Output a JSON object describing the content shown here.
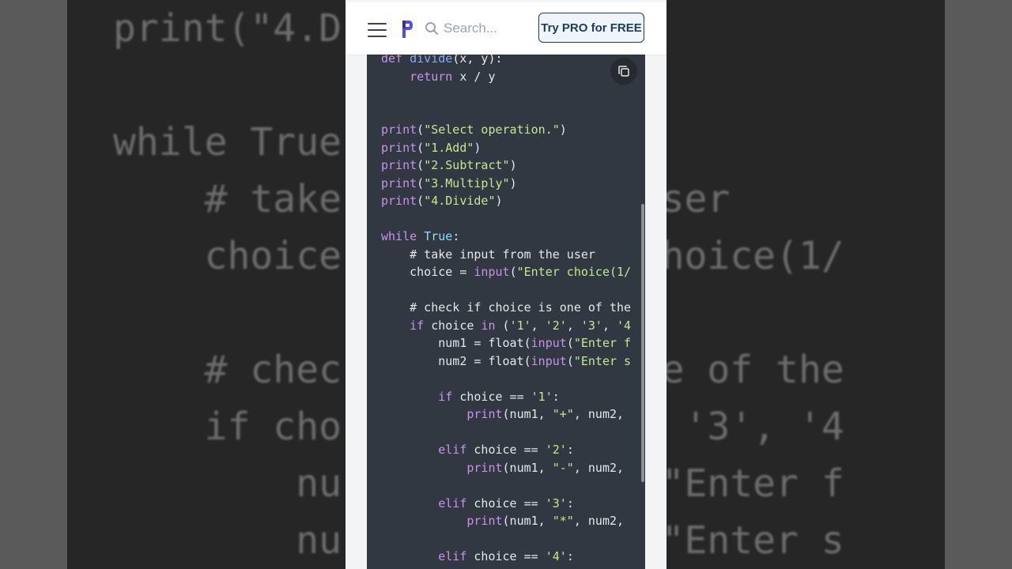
{
  "header": {
    "search_placeholder": "Search...",
    "pro_button_label": "Try PRO for FREE"
  },
  "background_code": {
    "lines": [
      "print(\"4.D",
      "",
      "while True",
      "    # take          he user",
      "    choice          er choice(1/",
      "",
      "    # chec          s one of the",
      "    if cho          '2', '3', '4",
      "        nu          put(\"Enter f",
      "        nu          put(\"Enter s"
    ]
  },
  "code": {
    "lines": [
      [
        {
          "t": "def ",
          "c": "kw"
        },
        {
          "t": "divide",
          "c": "fn"
        },
        {
          "t": "(x, y):",
          "c": ""
        }
      ],
      [
        {
          "t": "    ",
          "c": ""
        },
        {
          "t": "return",
          "c": "kw"
        },
        {
          "t": " x / y",
          "c": ""
        }
      ],
      [],
      [],
      [
        {
          "t": "print",
          "c": "bi"
        },
        {
          "t": "(",
          "c": ""
        },
        {
          "t": "\"Select operation.\"",
          "c": "str"
        },
        {
          "t": ")",
          "c": ""
        }
      ],
      [
        {
          "t": "print",
          "c": "bi"
        },
        {
          "t": "(",
          "c": ""
        },
        {
          "t": "\"1.Add\"",
          "c": "str"
        },
        {
          "t": ")",
          "c": ""
        }
      ],
      [
        {
          "t": "print",
          "c": "bi"
        },
        {
          "t": "(",
          "c": ""
        },
        {
          "t": "\"2.Subtract\"",
          "c": "str"
        },
        {
          "t": ")",
          "c": ""
        }
      ],
      [
        {
          "t": "print",
          "c": "bi"
        },
        {
          "t": "(",
          "c": ""
        },
        {
          "t": "\"3.Multiply\"",
          "c": "str"
        },
        {
          "t": ")",
          "c": ""
        }
      ],
      [
        {
          "t": "print",
          "c": "bi"
        },
        {
          "t": "(",
          "c": ""
        },
        {
          "t": "\"4.Divide\"",
          "c": "str"
        },
        {
          "t": ")",
          "c": ""
        }
      ],
      [],
      [
        {
          "t": "while ",
          "c": "kw"
        },
        {
          "t": "True",
          "c": "tr"
        },
        {
          "t": ":",
          "c": ""
        }
      ],
      [
        {
          "t": "    # take input from the user",
          "c": "cm"
        }
      ],
      [
        {
          "t": "    choice = ",
          "c": ""
        },
        {
          "t": "input",
          "c": "bi"
        },
        {
          "t": "(",
          "c": ""
        },
        {
          "t": "\"Enter choice(1/",
          "c": "str"
        }
      ],
      [],
      [
        {
          "t": "    # check if choice is one of the",
          "c": "cm"
        }
      ],
      [
        {
          "t": "    ",
          "c": ""
        },
        {
          "t": "if",
          "c": "kw"
        },
        {
          "t": " choice ",
          "c": ""
        },
        {
          "t": "in",
          "c": "kw"
        },
        {
          "t": " (",
          "c": ""
        },
        {
          "t": "'1'",
          "c": "str"
        },
        {
          "t": ", ",
          "c": ""
        },
        {
          "t": "'2'",
          "c": "str"
        },
        {
          "t": ", ",
          "c": ""
        },
        {
          "t": "'3'",
          "c": "str"
        },
        {
          "t": ", ",
          "c": ""
        },
        {
          "t": "'4",
          "c": "str"
        }
      ],
      [
        {
          "t": "        num1 = float(",
          "c": ""
        },
        {
          "t": "input",
          "c": "bi"
        },
        {
          "t": "(",
          "c": ""
        },
        {
          "t": "\"Enter f",
          "c": "str"
        }
      ],
      [
        {
          "t": "        num2 = float(",
          "c": ""
        },
        {
          "t": "input",
          "c": "bi"
        },
        {
          "t": "(",
          "c": ""
        },
        {
          "t": "\"Enter s",
          "c": "str"
        }
      ],
      [],
      [
        {
          "t": "        ",
          "c": ""
        },
        {
          "t": "if",
          "c": "kw"
        },
        {
          "t": " choice == ",
          "c": ""
        },
        {
          "t": "'1'",
          "c": "str"
        },
        {
          "t": ":",
          "c": ""
        }
      ],
      [
        {
          "t": "            ",
          "c": ""
        },
        {
          "t": "print",
          "c": "bi"
        },
        {
          "t": "(num1, ",
          "c": ""
        },
        {
          "t": "\"+\"",
          "c": "str"
        },
        {
          "t": ", num2,",
          "c": ""
        }
      ],
      [],
      [
        {
          "t": "        ",
          "c": ""
        },
        {
          "t": "elif",
          "c": "kw"
        },
        {
          "t": " choice == ",
          "c": ""
        },
        {
          "t": "'2'",
          "c": "str"
        },
        {
          "t": ":",
          "c": ""
        }
      ],
      [
        {
          "t": "            ",
          "c": ""
        },
        {
          "t": "print",
          "c": "bi"
        },
        {
          "t": "(num1, ",
          "c": ""
        },
        {
          "t": "\"-\"",
          "c": "str"
        },
        {
          "t": ", num2,",
          "c": ""
        }
      ],
      [],
      [
        {
          "t": "        ",
          "c": ""
        },
        {
          "t": "elif",
          "c": "kw"
        },
        {
          "t": " choice == ",
          "c": ""
        },
        {
          "t": "'3'",
          "c": "str"
        },
        {
          "t": ":",
          "c": ""
        }
      ],
      [
        {
          "t": "            ",
          "c": ""
        },
        {
          "t": "print",
          "c": "bi"
        },
        {
          "t": "(num1, ",
          "c": ""
        },
        {
          "t": "\"*\"",
          "c": "str"
        },
        {
          "t": ", num2,",
          "c": ""
        }
      ],
      [],
      [
        {
          "t": "        ",
          "c": ""
        },
        {
          "t": "elif",
          "c": "kw"
        },
        {
          "t": " choice == ",
          "c": ""
        },
        {
          "t": "'4'",
          "c": "str"
        },
        {
          "t": ":",
          "c": ""
        }
      ]
    ]
  },
  "colors": {
    "code_background": "#323842",
    "keyword": "#c792ea",
    "string": "#c3e88d",
    "function": "#82aaff",
    "accent": "#1e3a5f"
  },
  "icons": [
    "menu-icon",
    "logo-icon",
    "search-icon",
    "copy-icon"
  ]
}
